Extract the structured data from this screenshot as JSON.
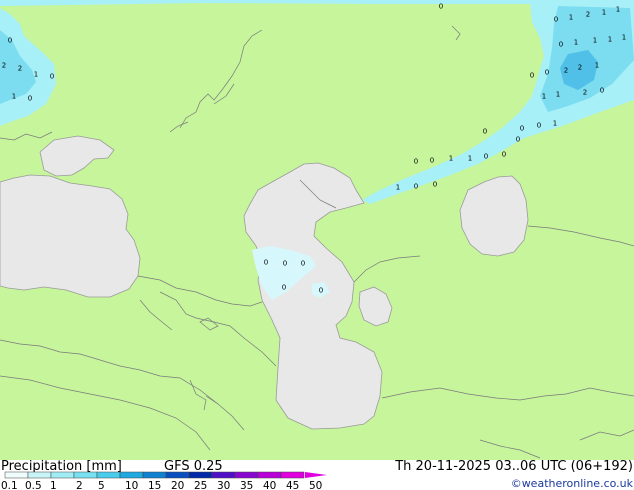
{
  "map": {
    "colors": {
      "land": "#c6f59c",
      "water": "#e8e8e8",
      "coast": "#9a9a9a",
      "border": "#7a7a7a",
      "precip_light": "#a8f0f8",
      "precip_mid": "#7cdcf0",
      "precip_strong": "#50c0e8"
    },
    "grid_values": [
      {
        "v": "0"
      },
      {
        "v": "0"
      },
      {
        "v": "2"
      },
      {
        "v": "2"
      },
      {
        "v": "1"
      },
      {
        "v": "0"
      },
      {
        "v": "1"
      },
      {
        "v": "0"
      },
      {
        "v": "0"
      },
      {
        "v": "1"
      },
      {
        "v": "2"
      },
      {
        "v": "1"
      },
      {
        "v": "1"
      },
      {
        "v": "0"
      },
      {
        "v": "1"
      },
      {
        "v": "1"
      },
      {
        "v": "1"
      },
      {
        "v": "1"
      },
      {
        "v": "0"
      },
      {
        "v": "0"
      },
      {
        "v": "2"
      },
      {
        "v": "2"
      },
      {
        "v": "1"
      },
      {
        "v": "1"
      },
      {
        "v": "1"
      },
      {
        "v": "2"
      },
      {
        "v": "0"
      },
      {
        "v": "0"
      },
      {
        "v": "0"
      },
      {
        "v": "1"
      },
      {
        "v": "0"
      },
      {
        "v": "0"
      },
      {
        "v": "0"
      },
      {
        "v": "1"
      },
      {
        "v": "1"
      },
      {
        "v": "0"
      },
      {
        "v": "0"
      },
      {
        "v": "0"
      },
      {
        "v": "1"
      },
      {
        "v": "0"
      },
      {
        "v": "0"
      },
      {
        "v": "0"
      },
      {
        "v": "0"
      },
      {
        "v": "0"
      },
      {
        "v": "0"
      },
      {
        "v": "0"
      }
    ]
  },
  "legend": {
    "title": "Precipitation [mm]",
    "model": "GFS 0.25",
    "valid_time": "Th 20-11-2025 03..06 UTC (06+192)",
    "credit": "©weatheronline.co.uk",
    "ticks": [
      "0.1",
      "0.5",
      "1",
      "2",
      "5",
      "10",
      "15",
      "20",
      "25",
      "30",
      "35",
      "40",
      "45",
      "50"
    ],
    "swatches": [
      "#eefcfc",
      "#c8f4f8",
      "#a0ecf4",
      "#78e0f0",
      "#48ccec",
      "#20a8e0",
      "#1080d0",
      "#0850c0",
      "#0028a8",
      "#5010c8",
      "#8808d0",
      "#b800d8",
      "#e000e0"
    ]
  }
}
